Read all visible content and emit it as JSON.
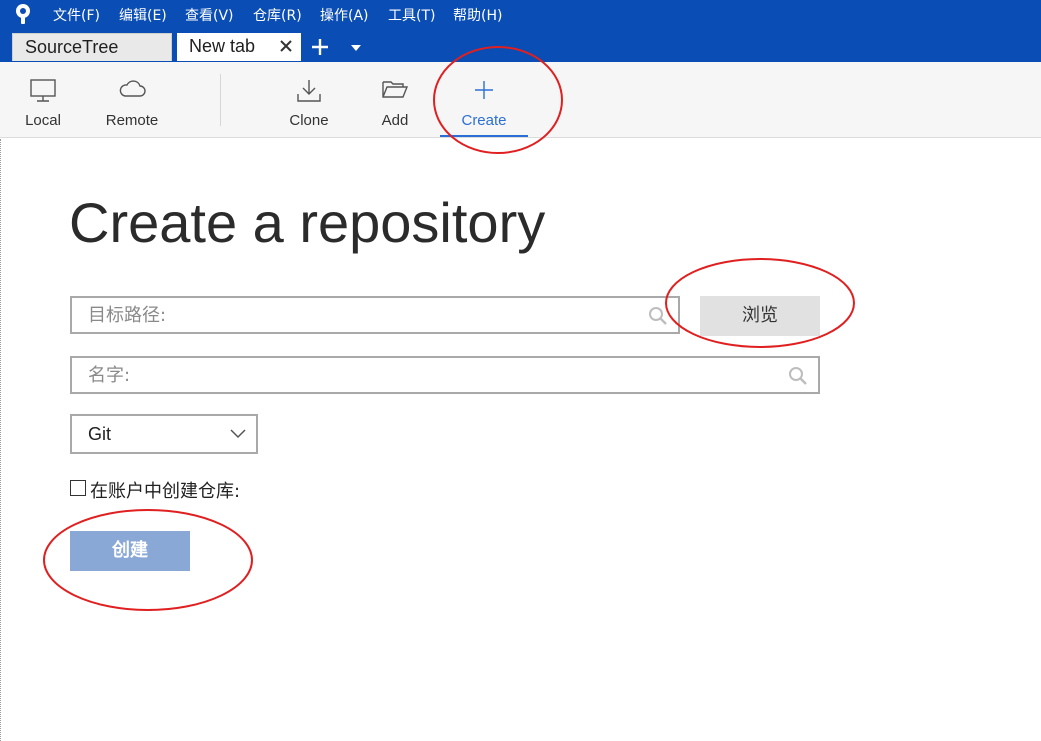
{
  "menubar": {
    "items": [
      "文件(F)",
      "编辑(E)",
      "查看(V)",
      "仓库(R)",
      "操作(A)",
      "工具(T)",
      "帮助(H)"
    ]
  },
  "tabs": [
    {
      "label": "SourceTree"
    },
    {
      "label": "New tab"
    }
  ],
  "toolbar": {
    "local": "Local",
    "remote": "Remote",
    "clone": "Clone",
    "add": "Add",
    "create": "Create"
  },
  "page": {
    "title": "Create a repository",
    "path_placeholder": "目标路径:",
    "browse_label": "浏览",
    "name_placeholder": "名字:",
    "vcs_selected": "Git",
    "checkbox_label": "在账户中创建仓库:",
    "create_button": "创建"
  },
  "colors": {
    "brand": "#0a4db4",
    "accent": "#2b6fd6",
    "create_button": "#8aa8d6",
    "annotation": "#e02020"
  }
}
